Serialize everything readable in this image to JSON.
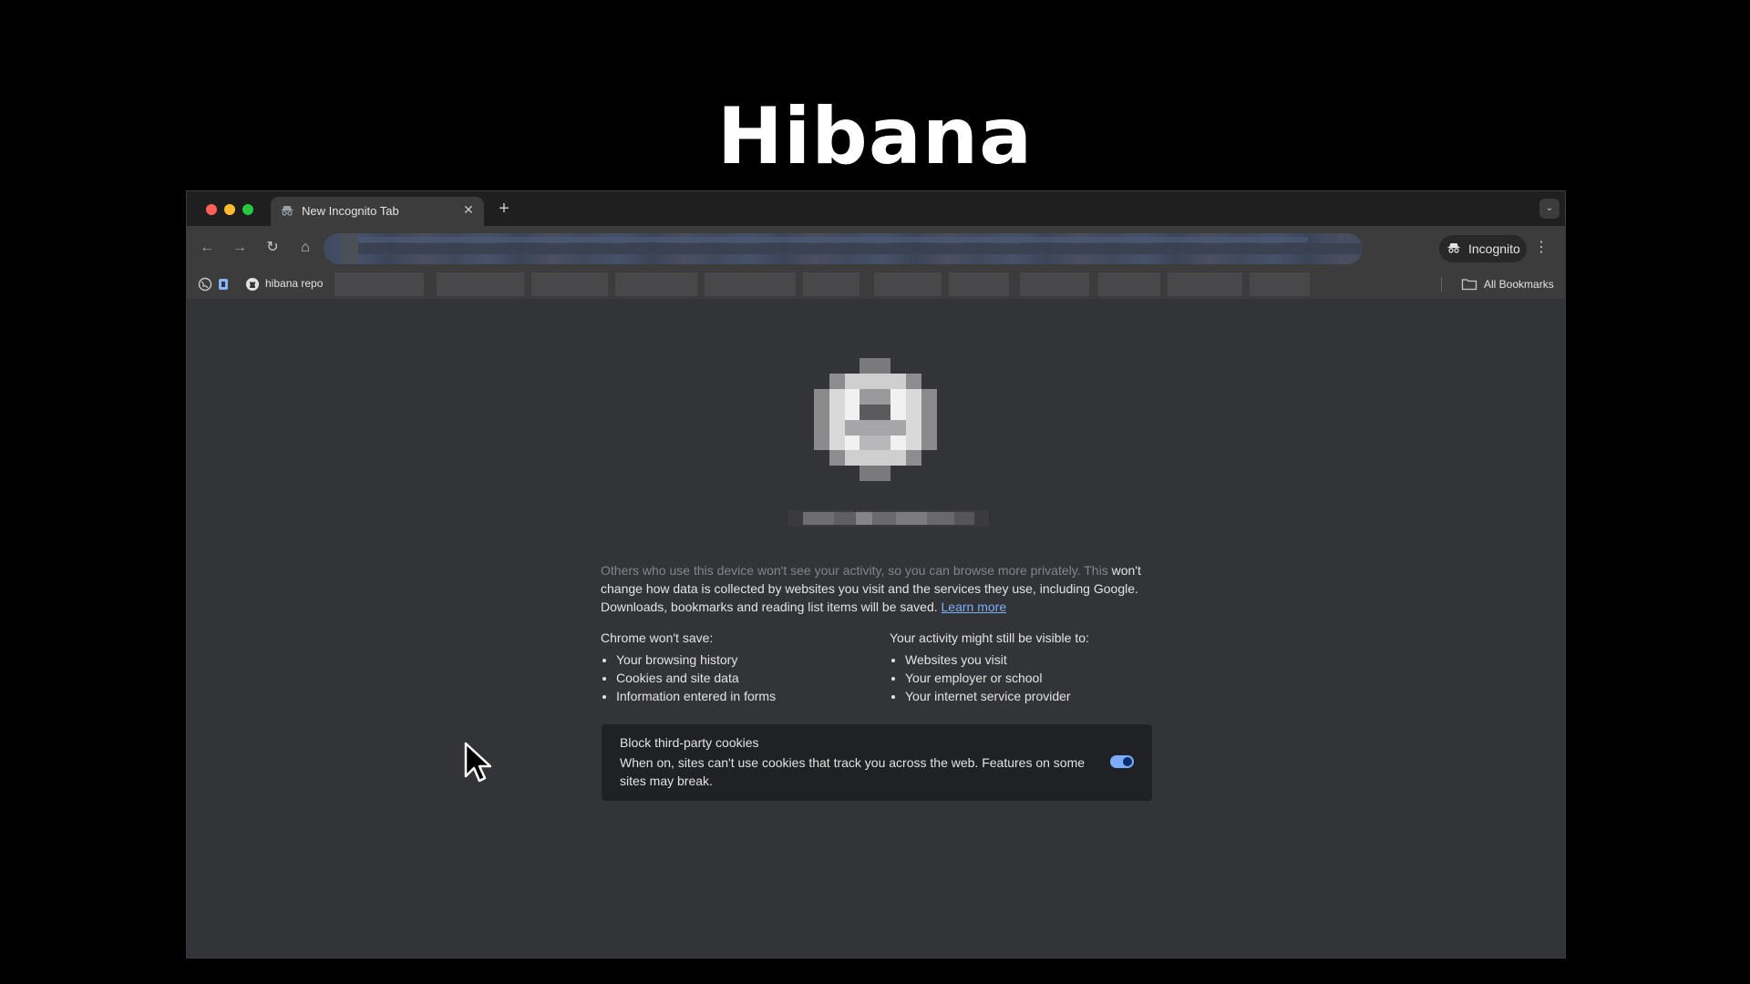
{
  "slide": {
    "title": "Hibana"
  },
  "browser": {
    "tab": {
      "title": "New Incognito Tab",
      "close": "✕"
    },
    "new_tab": "+",
    "tab_search": "⌄",
    "toolbar": {
      "back": "←",
      "forward": "→",
      "reload": "↻",
      "home": "⌂",
      "incognito_label": "Incognito",
      "menu": "⋮"
    },
    "bookmarks": {
      "item_label": "hibana repo",
      "all_bookmarks": "All Bookmarks"
    }
  },
  "page": {
    "intro_faded": "Others who use this device won't see your activity, so you can browse more privately. This",
    "intro_rest": "won't change how data is collected by websites you visit and the services they use, including Google. Downloads, bookmarks and reading list items will be saved.",
    "learn_more": "Learn more",
    "wont_save": {
      "heading": "Chrome won't save:",
      "items": [
        "Your browsing history",
        "Cookies and site data",
        "Information entered in forms"
      ]
    },
    "visible_to": {
      "heading": "Your activity might still be visible to:",
      "items": [
        "Websites you visit",
        "Your employer or school",
        "Your internet service provider"
      ]
    },
    "cookies": {
      "title": "Block third-party cookies",
      "description": "When on, sites can't use cookies that track you across the web. Features on some sites may break.",
      "enabled": true
    }
  },
  "colors": {
    "accent": "#7cacf8",
    "content_bg": "#333437",
    "card_bg": "#202124"
  }
}
